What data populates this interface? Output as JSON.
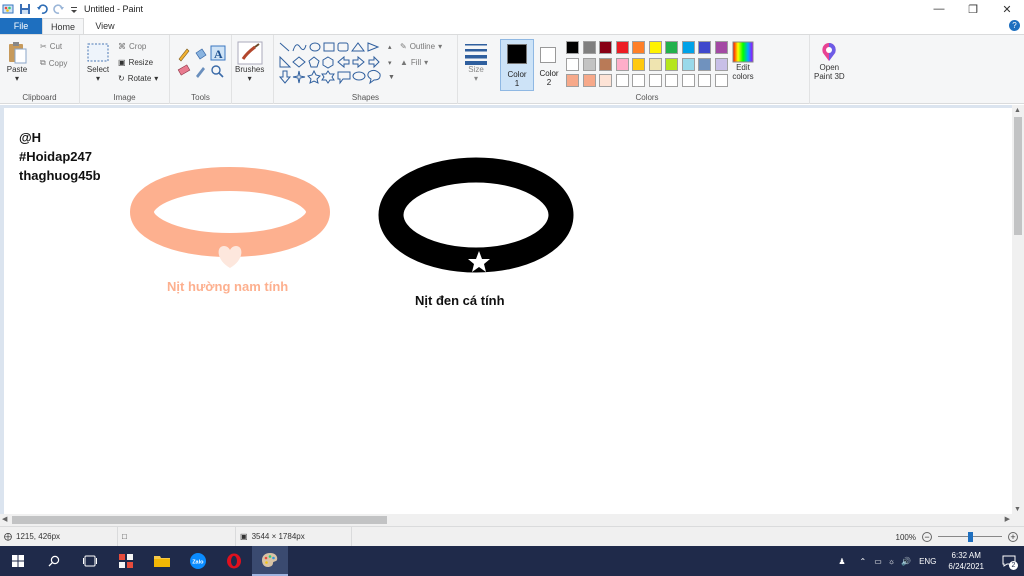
{
  "window": {
    "title": "Untitled - Paint"
  },
  "tabs": {
    "file": "File",
    "home": "Home",
    "view": "View"
  },
  "ribbon": {
    "clipboard": {
      "label": "Clipboard",
      "paste": "Paste",
      "cut": "Cut",
      "copy": "Copy"
    },
    "image": {
      "label": "Image",
      "select": "Select",
      "crop": "Crop",
      "resize": "Resize",
      "rotate": "Rotate"
    },
    "tools": {
      "label": "Tools"
    },
    "brushes": {
      "label": "Brushes"
    },
    "shapes": {
      "label": "Shapes",
      "outline": "Outline",
      "fill": "Fill"
    },
    "size": {
      "label": "Size"
    },
    "color1": {
      "label": "Color",
      "num": "1"
    },
    "color2": {
      "label": "Color",
      "num": "2"
    },
    "colors": {
      "label": "Colors",
      "edit_label": "Edit",
      "edit_label2": "colors"
    },
    "paint3d": {
      "label": "Open",
      "label2": "Paint 3D"
    }
  },
  "palette": {
    "row1": [
      "#000000",
      "#7f7f7f",
      "#880015",
      "#ed1c24",
      "#ff7f27",
      "#fff200",
      "#22b14c",
      "#00a2e8",
      "#3f48cc",
      "#a349a4"
    ],
    "row2": [
      "#ffffff",
      "#c3c3c3",
      "#b97a57",
      "#ffaec9",
      "#ffc90e",
      "#efe4b0",
      "#b5e61d",
      "#99d9ea",
      "#7092be",
      "#c8bfe7"
    ],
    "row3": [
      "#f7a98a",
      "#f7a98a",
      "#fde3d6",
      "#ffffff",
      "#ffffff",
      "#ffffff",
      "#ffffff",
      "#ffffff",
      "#ffffff",
      "#ffffff"
    ]
  },
  "canvas": {
    "watermark": {
      "line1": "@H",
      "line2": "#Hoidap247",
      "line3": "thaghuog45b"
    },
    "left_caption": "Nịt hường nam tính",
    "right_caption": "Nịt đen cá tính",
    "peach_color": "#fdb08f",
    "black_color": "#000000"
  },
  "status": {
    "cursor": "1215, 426px",
    "size": "3544 × 1784px",
    "zoom": "100%"
  },
  "taskbar": {
    "time": "6:32 AM",
    "date": "6/24/2021",
    "lang": "ENG",
    "notif": "2"
  }
}
